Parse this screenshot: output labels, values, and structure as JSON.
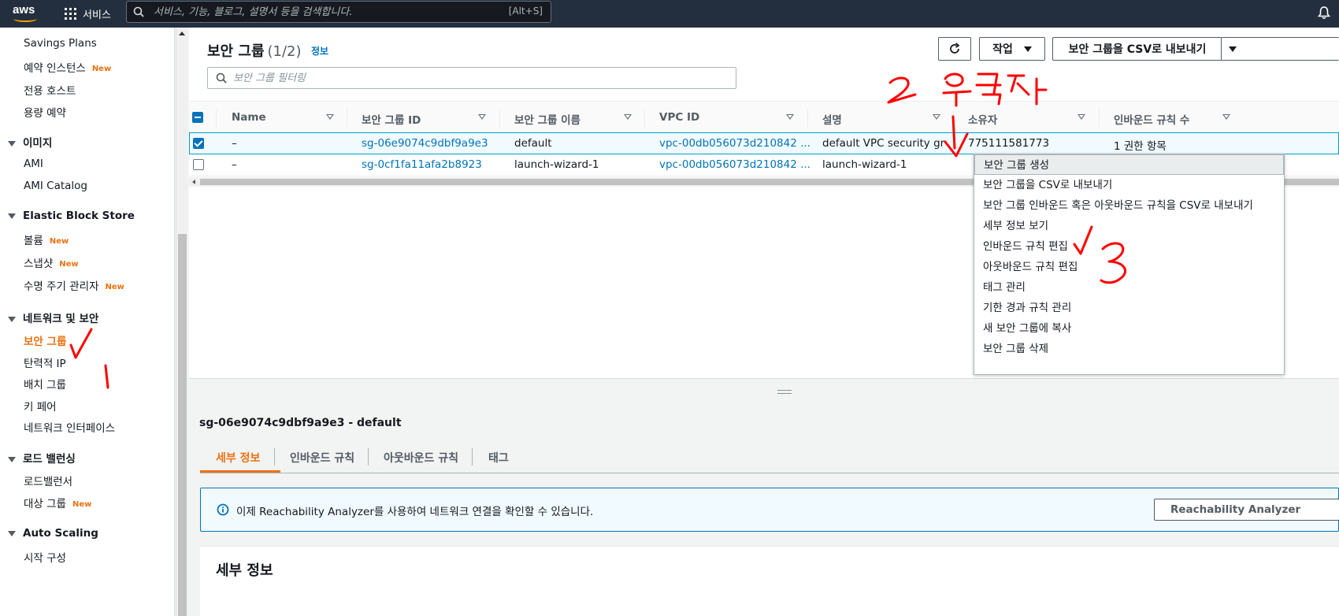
{
  "topnav": {
    "logo_text": "aws",
    "services_label": "서비스",
    "search_placeholder": "서비스, 기능, 블로그, 설명서 등을 검색합니다.",
    "search_shortcut": "[Alt+S]"
  },
  "sidebar": {
    "savings_plans": "Savings Plans",
    "reserved_instances": "예약 인스턴스",
    "dedicated_hosts": "전용 호스트",
    "capacity_reservations": "용량 예약",
    "images_header": "이미지",
    "ami": "AMI",
    "ami_catalog": "AMI Catalog",
    "ebs_header": "Elastic Block Store",
    "volumes": "볼륨",
    "snapshots": "스냅샷",
    "lifecycle_manager": "수명 주기 관리자",
    "network_header": "네트워크 및 보안",
    "security_groups": "보안 그룹",
    "elastic_ips": "탄력적 IP",
    "placement_groups": "배치 그룹",
    "key_pairs": "키 페어",
    "network_interfaces": "네트워크 인터페이스",
    "lb_header": "로드 밸런싱",
    "load_balancers": "로드밸런서",
    "target_groups": "대상 그룹",
    "autoscaling_header": "Auto Scaling",
    "launch_configs": "시작 구성",
    "new_badge": "New"
  },
  "list": {
    "title": "보안 그룹",
    "count": "(1/2)",
    "info_link": "정보",
    "refresh_icon": "refresh-icon",
    "actions_label": "작업",
    "export_label": "보안 그룹을 CSV로 내보내기",
    "filter_placeholder": "보안 그룹 필터링",
    "columns": [
      "Name",
      "보안 그룹 ID",
      "보안 그룹 이름",
      "VPC ID",
      "설명",
      "소유자",
      "인바운드 규칙 수"
    ],
    "rows": [
      {
        "name": "–",
        "id": "sg-06e9074c9dbf9a9e3",
        "group_name": "default",
        "vpc": "vpc-00db056073d210842 ...",
        "desc": "default VPC security gr",
        "owner": "775111581773",
        "inbound": "1 권한 항목"
      },
      {
        "name": "–",
        "id": "sg-0cf1fa11afa2b8923",
        "group_name": "launch-wizard-1",
        "vpc": "vpc-00db056073d210842 ...",
        "desc": "launch-wizard-1",
        "owner": "",
        "inbound": ""
      }
    ]
  },
  "context_menu": {
    "items": [
      "보안 그룹 생성",
      "보안 그룹을 CSV로 내보내기",
      "보안 그룹 인바운드 혹은 아웃바운드 규칙을 CSV로 내보내기",
      "세부 정보 보기",
      "인바운드 규칙 편집",
      "아웃바운드 규칙 편집",
      "태그 관리",
      "기한 경과 규칙 관리",
      "새 보안 그룹에 복사",
      "보안 그룹 삭제"
    ]
  },
  "detail": {
    "title": "sg-06e9074c9dbf9a9e3 - default",
    "tabs": [
      "세부 정보",
      "인바운드 규칙",
      "아웃바운드 규칙",
      "태그"
    ],
    "alert_text": "이제 Reachability Analyzer를 사용하여 네트워크 연결을 확인할 수 있습니다.",
    "alert_button": "Reachability Analyzer",
    "section_title": "세부 정보"
  },
  "colors": {
    "nav_bg": "#232f3e",
    "accent_orange": "#ec7211",
    "link_blue": "#0073bb",
    "annotation_red": "#ff0000"
  }
}
